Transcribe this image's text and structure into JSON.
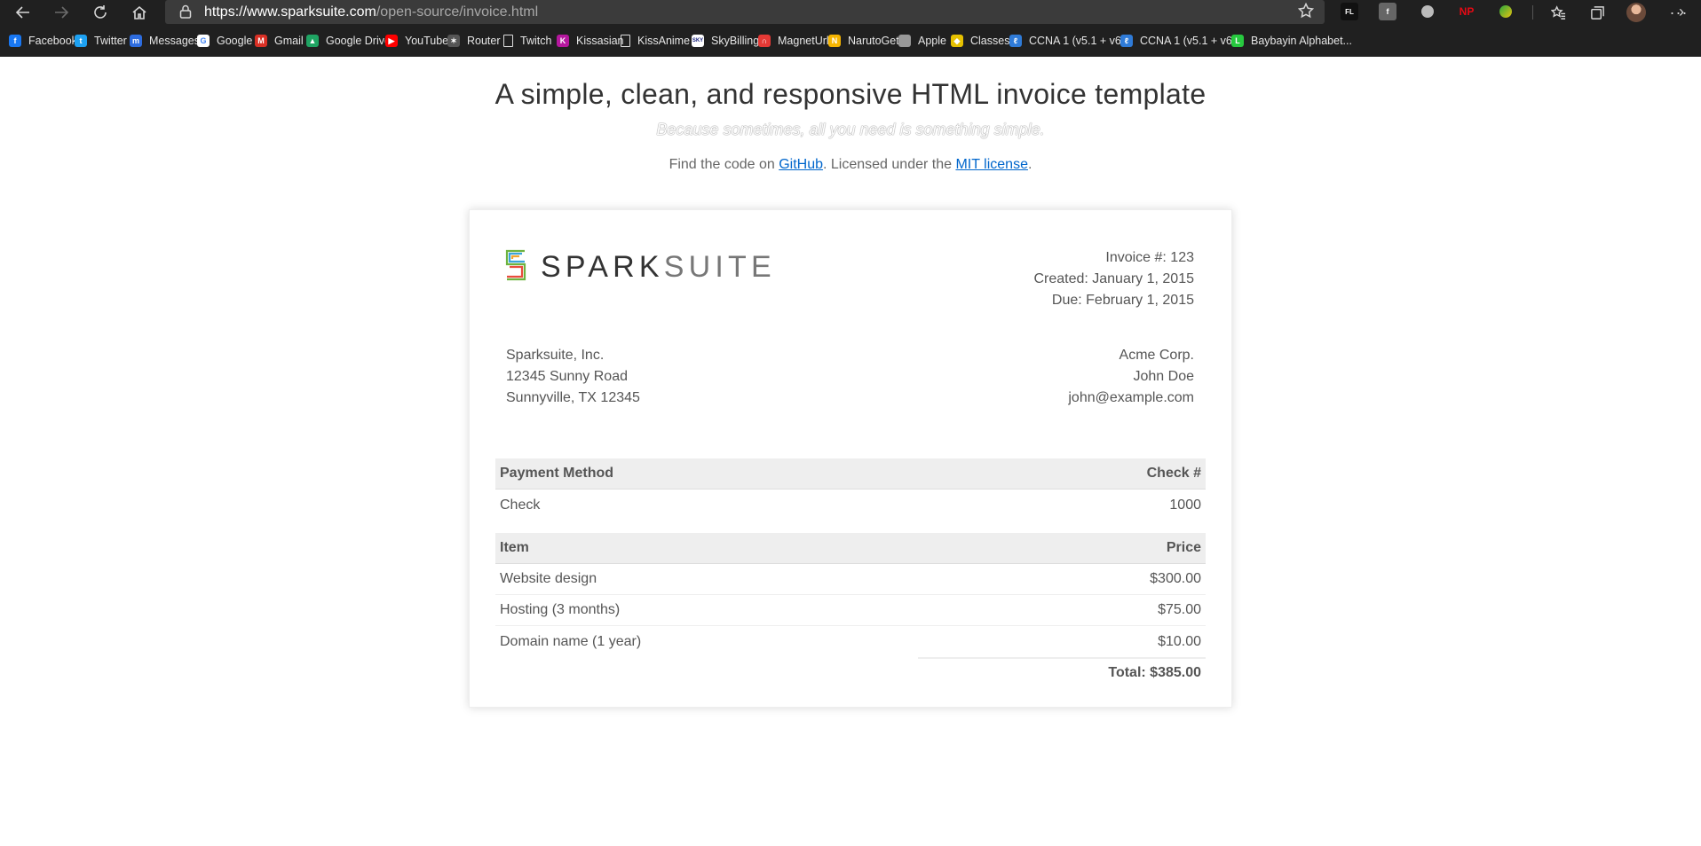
{
  "browser": {
    "url_host": "https://www.sparksuite.com",
    "url_path": "/open-source/invoice.html",
    "extensions": {
      "fl": "FL",
      "np": "NP"
    },
    "bookmarks": [
      {
        "label": "Facebook",
        "icon": "facebook-icon",
        "color": "#1877f2",
        "glyph": "f"
      },
      {
        "label": "Twitter",
        "icon": "twitter-icon",
        "color": "#1da1f2",
        "glyph": "t"
      },
      {
        "label": "Messages",
        "icon": "messages-icon",
        "color": "#2d6cdf",
        "glyph": "m"
      },
      {
        "label": "Google",
        "icon": "google-icon",
        "color": "#ffffff",
        "glyph": "G"
      },
      {
        "label": "Gmail",
        "icon": "gmail-icon",
        "color": "#d93025",
        "glyph": "M"
      },
      {
        "label": "Google Drive",
        "icon": "google-drive-icon",
        "color": "#1fa463",
        "glyph": "▲"
      },
      {
        "label": "YouTube",
        "icon": "youtube-icon",
        "color": "#ff0000",
        "glyph": "▶"
      },
      {
        "label": "Router",
        "icon": "router-icon",
        "color": "#555555",
        "glyph": "✶"
      },
      {
        "label": "Twitch",
        "icon": "page-icon",
        "color": "#202020",
        "glyph": ""
      },
      {
        "label": "Kissasian",
        "icon": "kissasian-icon",
        "color": "#b5179e",
        "glyph": "K"
      },
      {
        "label": "KissAnime",
        "icon": "page-icon",
        "color": "#202020",
        "glyph": ""
      },
      {
        "label": "SkyBilling",
        "icon": "skybilling-icon",
        "color": "#ffffff",
        "glyph": "SKY"
      },
      {
        "label": "MagnetUrl",
        "icon": "magnet-icon",
        "color": "#e53935",
        "glyph": "∩"
      },
      {
        "label": "NarutoGet",
        "icon": "narutoget-icon",
        "color": "#f5b400",
        "glyph": "N"
      },
      {
        "label": "Apple",
        "icon": "apple-icon",
        "color": "#999999",
        "glyph": ""
      },
      {
        "label": "Classes",
        "icon": "classes-icon",
        "color": "#e6c100",
        "glyph": "◆"
      },
      {
        "label": "CCNA 1 (v5.1 + v6....",
        "icon": "ccna-icon",
        "color": "#2f7bd8",
        "glyph": "ℓ"
      },
      {
        "label": "CCNA 1 (v5.1 + v6....",
        "icon": "ccna-icon",
        "color": "#2f7bd8",
        "glyph": "ℓ"
      },
      {
        "label": "Baybayin Alphabet...",
        "icon": "baybayin-icon",
        "color": "#27c93f",
        "glyph": "L"
      }
    ]
  },
  "page": {
    "headline": "A simple, clean, and responsive HTML invoice template",
    "tagline": "Because sometimes, all you need is something simple.",
    "find_prefix": "Find the code on ",
    "github_link": "GitHub",
    "license_mid": ". Licensed under the ",
    "license_link": "MIT license",
    "find_suffix": "."
  },
  "invoice": {
    "logo_spark": "SPARK",
    "logo_suite": "SUITE",
    "number": "Invoice #: 123",
    "created": "Created: January 1, 2015",
    "due": "Due: February 1, 2015",
    "from": [
      "Sparksuite, Inc.",
      "12345 Sunny Road",
      "Sunnyville, TX 12345"
    ],
    "to": [
      "Acme Corp.",
      "John Doe",
      "john@example.com"
    ],
    "payment_header": {
      "left": "Payment Method",
      "right": "Check #"
    },
    "payment_row": {
      "left": "Check",
      "right": "1000"
    },
    "items_header": {
      "left": "Item",
      "right": "Price"
    },
    "items": [
      {
        "name": "Website design",
        "price": "$300.00"
      },
      {
        "name": "Hosting (3 months)",
        "price": "$75.00"
      },
      {
        "name": "Domain name (1 year)",
        "price": "$10.00"
      }
    ],
    "total": "Total: $385.00"
  }
}
